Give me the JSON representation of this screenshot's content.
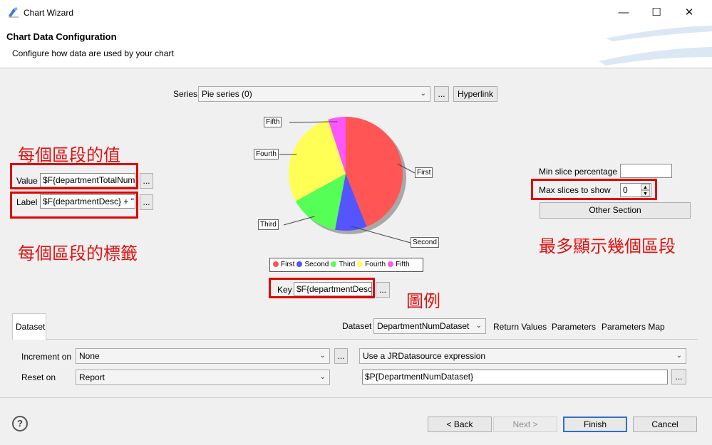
{
  "window": {
    "title": "Chart Wizard",
    "header_title": "Chart Data Configuration",
    "header_desc": "Configure how data are used by your chart"
  },
  "series": {
    "label": "Series",
    "value": "Pie series (0)",
    "ellipsis": "...",
    "hyperlink": "Hyperlink"
  },
  "value_field": {
    "label": "Value",
    "value": "$F{departmentTotalNum",
    "ellipsis": "..."
  },
  "label_field": {
    "label": "Label",
    "value": "$F{departmentDesc} + \"",
    "ellipsis": "..."
  },
  "key_field": {
    "label": "Key",
    "value": "$F{departmentDesc",
    "ellipsis": "..."
  },
  "right_panel": {
    "min_slice_label": "Min slice percentage",
    "min_slice_value": "",
    "max_slices_label": "Max slices to show",
    "max_slices_value": "0",
    "other_section": "Other Section"
  },
  "annotations": {
    "value_note": "每個區段的值",
    "label_note": "每個區段的標籤",
    "max_note": "最多顯示幾個區段",
    "legend_note": "圖例"
  },
  "chart_data": {
    "type": "pie",
    "categories": [
      "First",
      "Second",
      "Third",
      "Fourth",
      "Fifth"
    ],
    "values": [
      44,
      9,
      14,
      28,
      5
    ],
    "colors": [
      "#ff5555",
      "#5555ff",
      "#55ff55",
      "#ffff55",
      "#ff55ff"
    ]
  },
  "dataset": {
    "tab": "Dataset",
    "dataset_label": "Dataset",
    "dataset_value": "DepartmentNumDataset",
    "return_values": "Return Values",
    "parameters": "Parameters",
    "parameters_map": "Parameters Map",
    "increment_label": "Increment on",
    "increment_value": "None",
    "reset_label": "Reset on",
    "reset_value": "Report",
    "source_value": "Use a JRDatasource expression",
    "expr_value": "$P{DepartmentNumDataset}",
    "ellipsis": "..."
  },
  "buttons": {
    "help": "?",
    "back": "< Back",
    "next": "Next >",
    "finish": "Finish",
    "cancel": "Cancel"
  },
  "icons": {
    "app": "chart-wizard-icon",
    "minimize": "minimize-icon",
    "maximize": "maximize-icon",
    "close": "close-icon"
  }
}
